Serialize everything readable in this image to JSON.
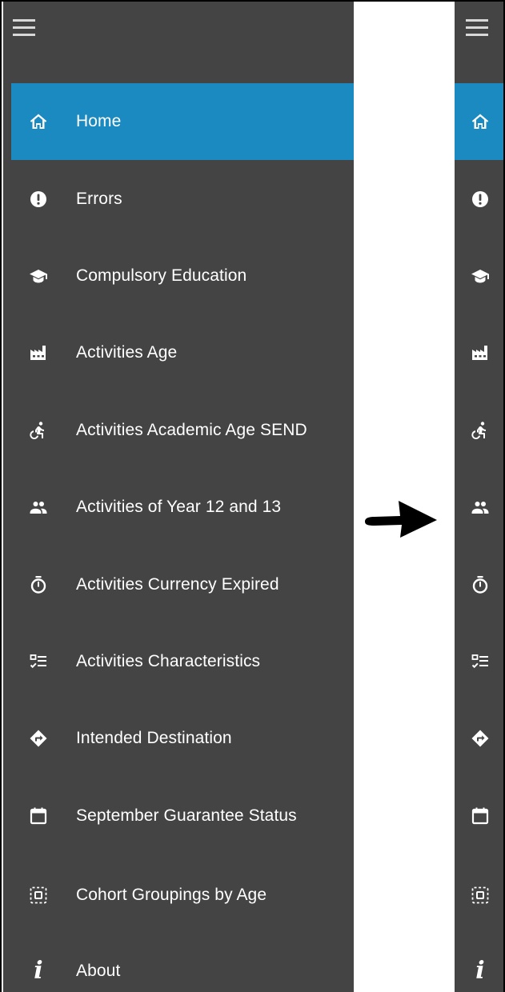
{
  "menu": {
    "items": [
      {
        "label": "Home",
        "icon": "home-icon",
        "active": true
      },
      {
        "label": "Errors",
        "icon": "alert-circle-icon",
        "active": false
      },
      {
        "label": "Compulsory Education",
        "icon": "graduation-cap-icon",
        "active": false
      },
      {
        "label": "Activities Age",
        "icon": "factory-icon",
        "active": false
      },
      {
        "label": "Activities Academic Age SEND",
        "icon": "accessible-icon",
        "active": false
      },
      {
        "label": "Activities of Year 12 and 13",
        "icon": "people-icon",
        "active": false
      },
      {
        "label": "Activities Currency Expired",
        "icon": "stopwatch-icon",
        "active": false
      },
      {
        "label": "Activities Characteristics",
        "icon": "checklist-icon",
        "active": false
      },
      {
        "label": "Intended Destination",
        "icon": "directions-icon",
        "active": false
      },
      {
        "label": "September Guarantee Status",
        "icon": "calendar-icon",
        "active": false
      },
      {
        "label": "Cohort Groupings by Age",
        "icon": "select-group-icon",
        "active": false
      },
      {
        "label": "About",
        "icon": "info-icon",
        "active": false
      }
    ]
  },
  "colors": {
    "panel_bg": "#444444",
    "active_bg": "#1a8ac0",
    "text": "#ffffff",
    "arrow": "#000000"
  }
}
